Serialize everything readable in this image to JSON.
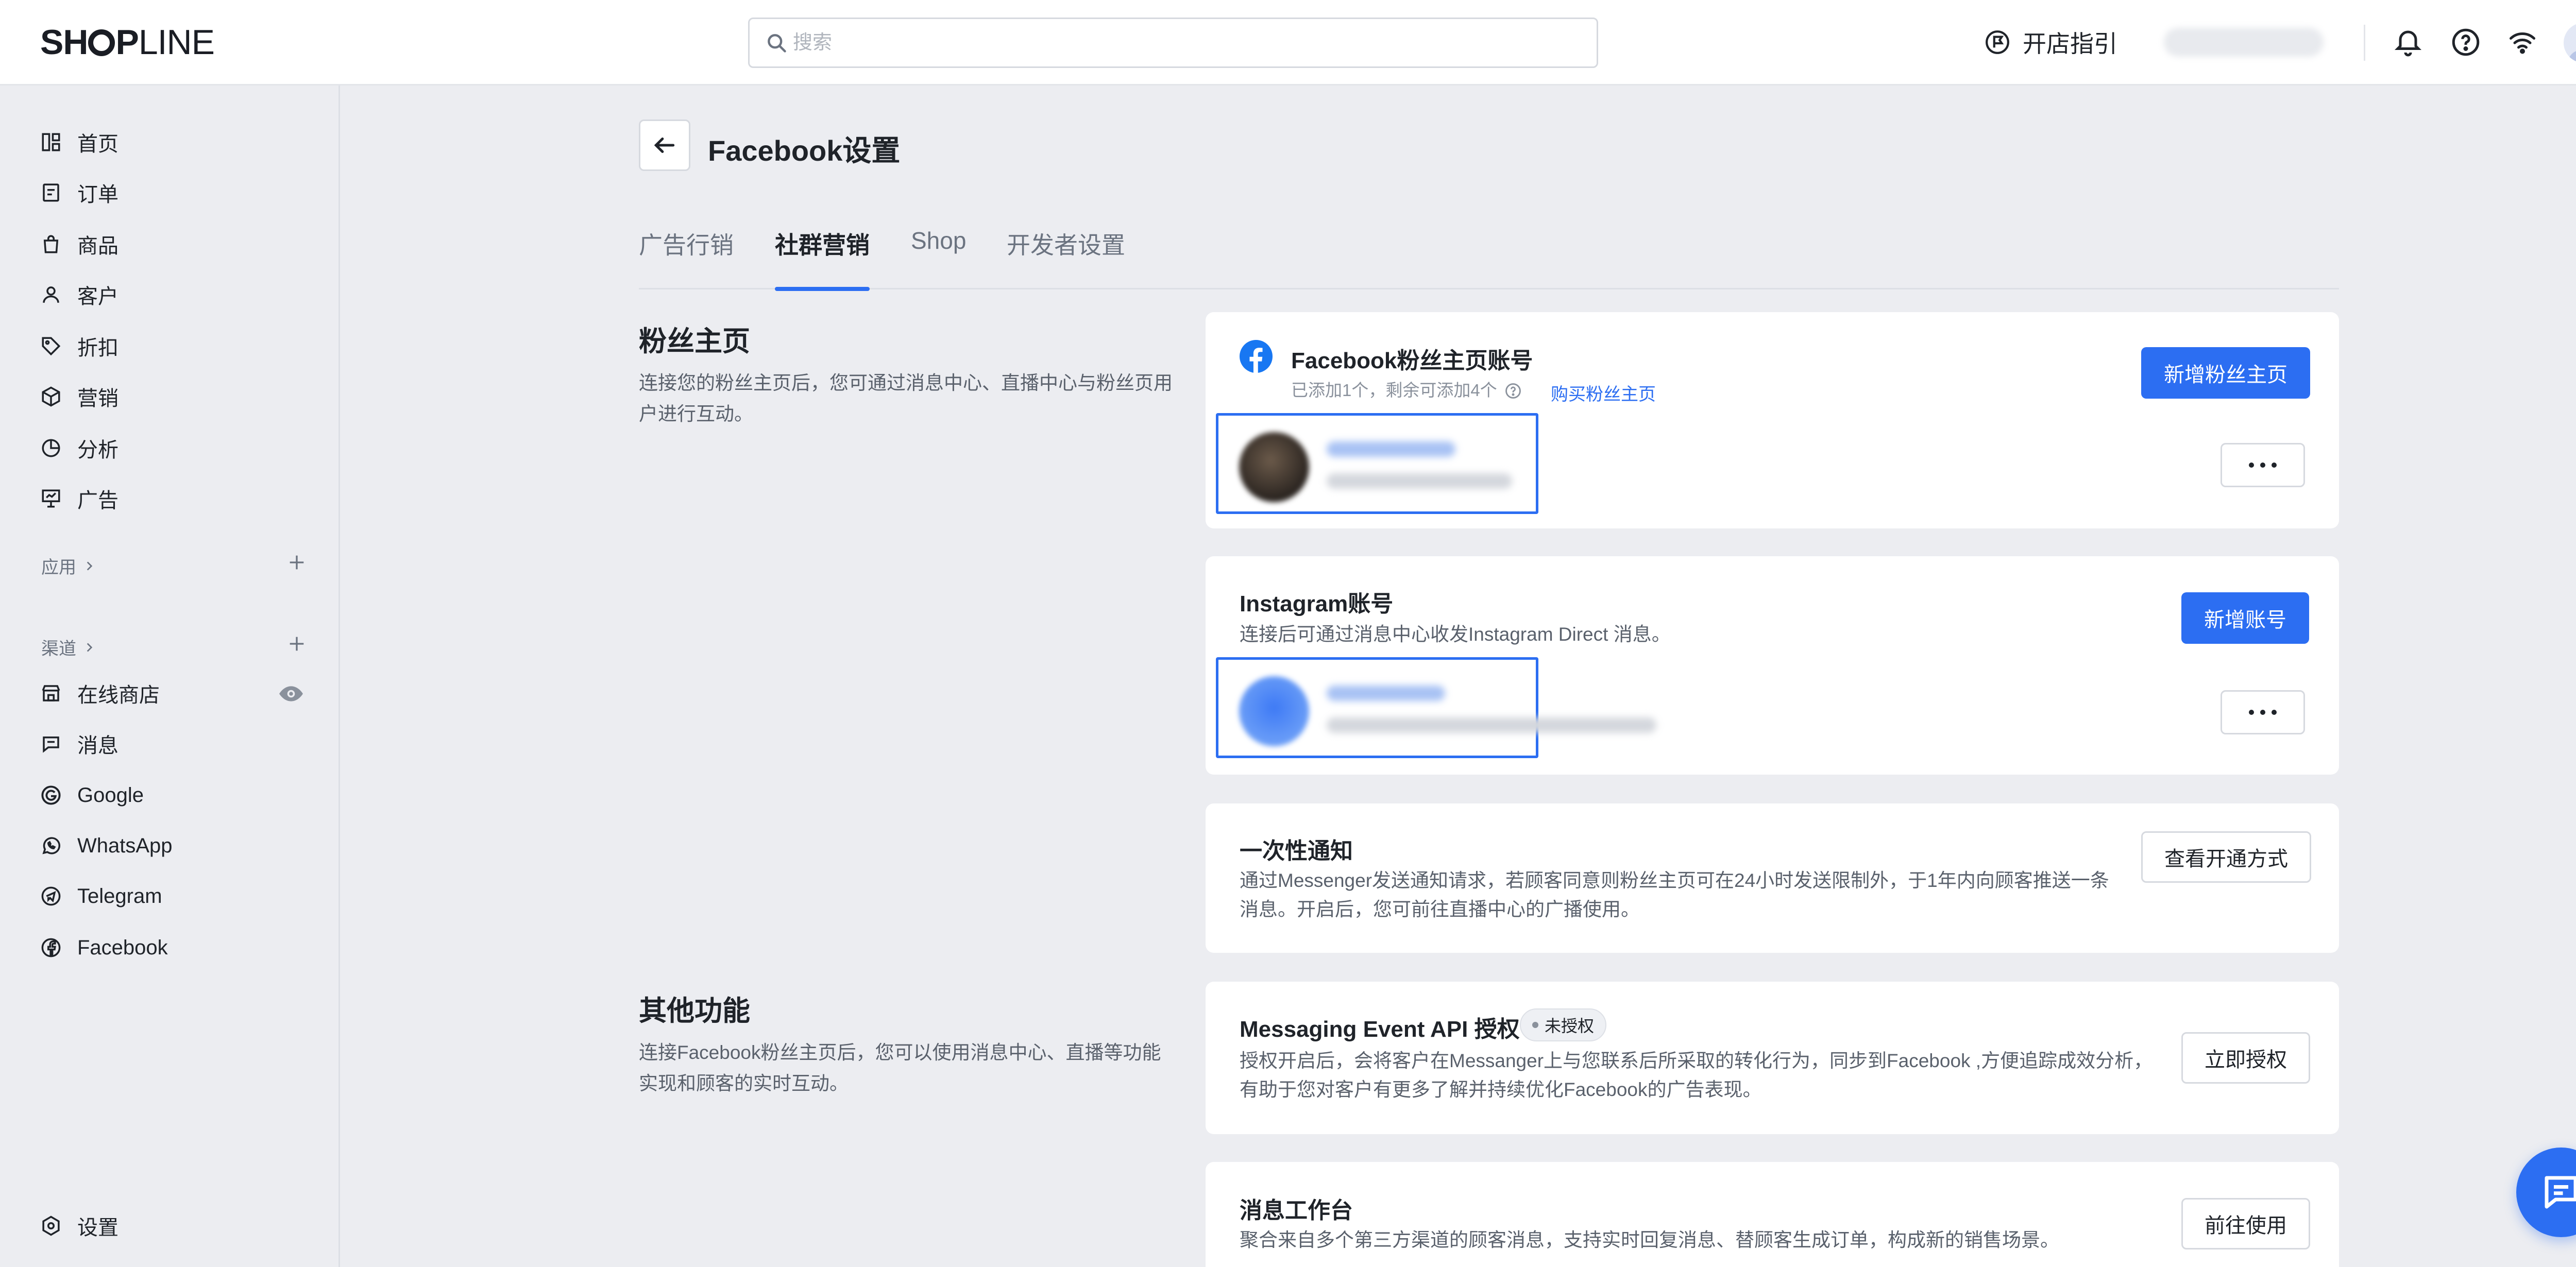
{
  "topbar": {
    "logo_left": "SH",
    "logo_bold_right": "P",
    "logo_light": "LINE",
    "search_placeholder": "搜索",
    "guide_label": "开店指引"
  },
  "sidebar": {
    "items": [
      {
        "label": "首页",
        "icon": "dashboard-icon"
      },
      {
        "label": "订单",
        "icon": "order-icon"
      },
      {
        "label": "商品",
        "icon": "bag-icon"
      },
      {
        "label": "客户",
        "icon": "user-icon"
      },
      {
        "label": "折扣",
        "icon": "tag-icon"
      },
      {
        "label": "营销",
        "icon": "box-icon"
      },
      {
        "label": "分析",
        "icon": "pie-icon"
      },
      {
        "label": "广告",
        "icon": "billboard-icon"
      }
    ],
    "apps_label": "应用",
    "channels_label": "渠道",
    "channels": [
      {
        "label": "在线商店",
        "icon": "store-icon"
      },
      {
        "label": "消息",
        "icon": "message-icon"
      },
      {
        "label": "Google",
        "icon": "google-icon"
      },
      {
        "label": "WhatsApp",
        "icon": "whatsapp-icon"
      },
      {
        "label": "Telegram",
        "icon": "telegram-icon"
      },
      {
        "label": "Facebook",
        "icon": "facebook-icon"
      }
    ],
    "settings_label": "设置"
  },
  "main": {
    "title": "Facebook设置",
    "tabs": [
      {
        "label": "广告行销",
        "active": false
      },
      {
        "label": "社群营销",
        "active": true
      },
      {
        "label": "Shop",
        "active": false
      },
      {
        "label": "开发者设置",
        "active": false
      }
    ],
    "fanpage_section": {
      "title": "粉丝主页",
      "desc": "连接您的粉丝主页后，您可通过消息中心、直播中心与粉丝页用户进行互动。"
    },
    "other_section": {
      "title": "其他功能",
      "desc": "连接Facebook粉丝主页后，您可以使用消息中心、直播等功能实现和顾客的实时互动。"
    },
    "fb_card": {
      "title": "Facebook粉丝主页账号",
      "sub": "已添加1个，剩余可添加4个",
      "buy_link": "购买粉丝主页",
      "add_button": "新增粉丝主页"
    },
    "ig_card": {
      "title": "Instagram账号",
      "sub": "连接后可通过消息中心收发Instagram Direct 消息。",
      "add_button": "新增账号"
    },
    "notify_card": {
      "title": "一次性通知",
      "sub": "通过Messenger发送通知请求，若顾客同意则粉丝主页可在24小时发送限制外，于1年内向顾客推送一条消息。开启后，您可前往直播中心的广播使用。",
      "button": "查看开通方式"
    },
    "api_card": {
      "title": "Messaging Event API 授权",
      "badge": "未授权",
      "sub": "授权开启后，会将客户在Messanger上与您联系后所采取的转化行为，同步到Facebook ,方便追踪成效分析，有助于您对客户有更多了解并持续优化Facebook的广告表现。",
      "button": "立即授权"
    },
    "workbench_card": {
      "title": "消息工作台",
      "sub": "聚合来自多个第三方渠道的顾客消息，支持实时回复消息、替顾客生成订单，构成新的销售场景。",
      "button": "前往使用"
    }
  },
  "colors": {
    "accent": "#2c6ef2",
    "facebook": "#1877f2",
    "background": "#ecedf1"
  }
}
